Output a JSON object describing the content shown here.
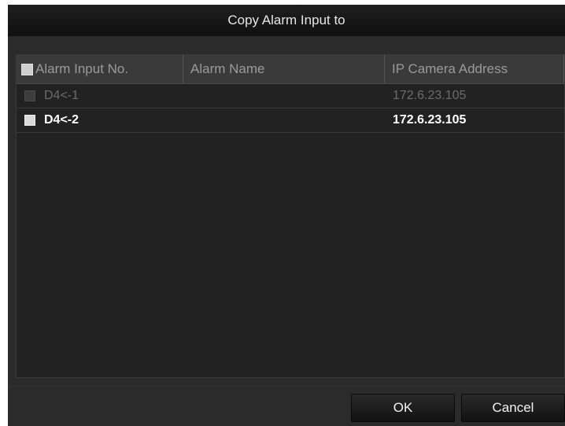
{
  "dialog": {
    "title": "Copy Alarm Input to"
  },
  "table": {
    "columns": [
      "Alarm Input No.",
      "Alarm Name",
      "IP Camera Address"
    ],
    "rows": [
      {
        "alarm_input_no": "D4<-1",
        "alarm_name": "",
        "ip_camera_address": "172.6.23.105",
        "state": "disabled",
        "checked": false
      },
      {
        "alarm_input_no": "D4<-2",
        "alarm_name": "",
        "ip_camera_address": "172.6.23.105",
        "state": "enabled",
        "checked": false
      }
    ]
  },
  "buttons": {
    "ok": "OK",
    "cancel": "Cancel"
  }
}
